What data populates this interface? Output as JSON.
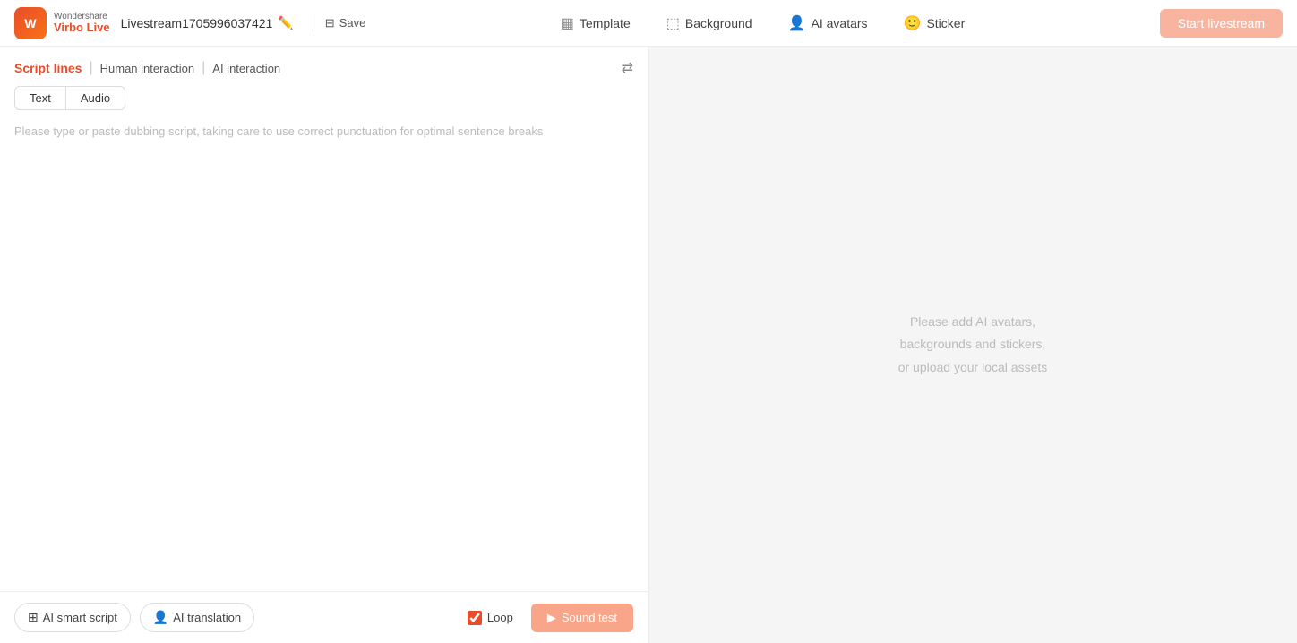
{
  "header": {
    "logo_brand": "Wondershare",
    "logo_product": "Virbo Live",
    "project_name": "Livestream1705996037421",
    "save_label": "Save",
    "nav_items": [
      {
        "id": "template",
        "label": "Template",
        "icon": "⊞"
      },
      {
        "id": "background",
        "label": "Background",
        "icon": "⬚"
      },
      {
        "id": "ai_avatars",
        "label": "AI avatars",
        "icon": "👤"
      },
      {
        "id": "sticker",
        "label": "Sticker",
        "icon": "🙂"
      }
    ],
    "start_btn_label": "Start livestream"
  },
  "left_panel": {
    "script_lines_label": "Script lines",
    "separator": "|",
    "human_interaction_label": "Human interaction",
    "ai_interaction_label": "AI interaction",
    "tabs": [
      {
        "id": "text",
        "label": "Text",
        "active": true
      },
      {
        "id": "audio",
        "label": "Audio",
        "active": false
      }
    ],
    "script_placeholder": "Please type or paste dubbing script, taking care to use correct punctuation for optimal sentence breaks",
    "bottom_buttons": [
      {
        "id": "ai_smart_script",
        "icon": "⊞",
        "label": "AI smart script"
      },
      {
        "id": "ai_translation",
        "icon": "👤",
        "label": "AI translation"
      }
    ],
    "loop_label": "Loop",
    "sound_test_label": "Sound test"
  },
  "right_panel": {
    "placeholder_line1": "Please add AI avatars,",
    "placeholder_line2": "backgrounds and stickers,",
    "placeholder_line3": "or upload your local assets"
  }
}
